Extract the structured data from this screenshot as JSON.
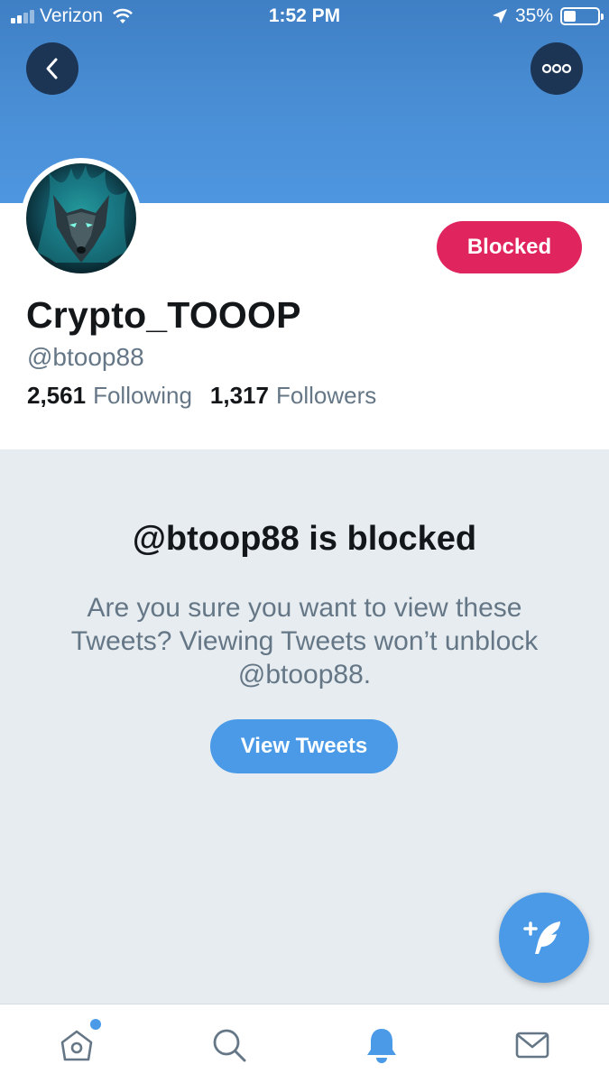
{
  "status_bar": {
    "carrier": "Verizon",
    "time": "1:52 PM",
    "battery_percent": "35%",
    "battery_level": 0.35
  },
  "header": {
    "back_icon": "chevron-left-icon",
    "more_icon": "more-horizontal-icon"
  },
  "profile": {
    "display_name": "Crypto_TOOOP",
    "handle": "@btoop88",
    "blocked_button_label": "Blocked",
    "following_count": "2,561",
    "following_label": "Following",
    "followers_count": "1,317",
    "followers_label": "Followers"
  },
  "blocked_notice": {
    "title": "@btoop88 is blocked",
    "description": "Are you sure you want to view these Tweets? Viewing Tweets won’t unblock @btoop88.",
    "view_button_label": "View Tweets"
  },
  "fab": {
    "icon": "compose-tweet-icon"
  },
  "tab_bar": {
    "tabs": [
      {
        "name": "home",
        "icon": "home-icon",
        "has_notification_dot": true
      },
      {
        "name": "search",
        "icon": "search-icon"
      },
      {
        "name": "notifications",
        "icon": "bell-icon",
        "active": true
      },
      {
        "name": "messages",
        "icon": "mail-icon"
      }
    ]
  },
  "colors": {
    "brand_blue": "#4a9ae8",
    "blocked_red": "#e0245e",
    "text_primary": "#14171a",
    "text_secondary": "#657786",
    "content_bg": "#e6ecf0"
  }
}
